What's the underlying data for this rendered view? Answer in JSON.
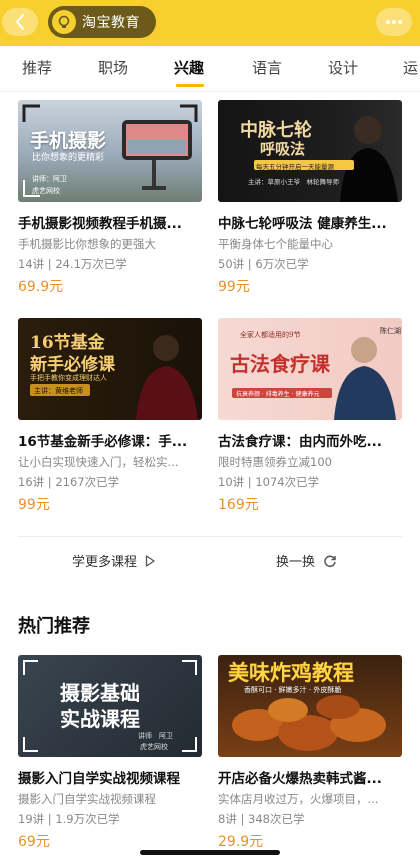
{
  "header": {
    "brand": "淘宝教育"
  },
  "tabs": [
    {
      "label": "推荐"
    },
    {
      "label": "职场"
    },
    {
      "label": "兴趣"
    },
    {
      "label": "语言"
    },
    {
      "label": "设计"
    },
    {
      "label": "运"
    }
  ],
  "courses": [
    {
      "title": "手机摄影视频教程手机摄...",
      "subtitle": "手机摄影比你想象的更强大",
      "lessons": "14讲",
      "learners": "24.1万次已学",
      "price": "69.9元",
      "thumb_text": [
        "手机摄影",
        "比你想象的更精彩",
        "讲师：阿卫",
        "虎艺网校"
      ]
    },
    {
      "title": "中脉七轮呼吸法 健康养生...",
      "subtitle": "平衡身体七个能量中心",
      "lessons": "50讲",
      "learners": "6万次已学",
      "price": "99元",
      "thumb_text": [
        "中脉七轮",
        "呼吸法",
        "每天五分钟开启一天能量源",
        "主讲：草原小王爷　林轮舞导师"
      ]
    },
    {
      "title": "16节基金新手必修课：手...",
      "subtitle": "让小白实现快速入门，轻松实...",
      "lessons": "16讲",
      "learners": "2167次已学",
      "price": "99元",
      "thumb_text": [
        "16节基金",
        "新手必修课",
        "手把手教你变成理财达人",
        "主讲：黄维老师"
      ]
    },
    {
      "title": "古法食疗课：由内而外吃...",
      "subtitle": "限时特惠领券立减100",
      "lessons": "10讲",
      "learners": "1074次已学",
      "price": "169元",
      "thumb_text": [
        "全家人都适用的9节",
        "古法食疗课",
        "抗衰养颜 · 排毒养生 · 健康养元",
        "陈仁湖"
      ]
    }
  ],
  "actions": {
    "more": "学更多课程",
    "refresh": "换一换"
  },
  "section": {
    "title": "热门推荐"
  },
  "hot": [
    {
      "title": "摄影入门自学实战视频课程",
      "subtitle": "摄影入门自学实战视频课程",
      "lessons": "19讲",
      "learners": "1.9万次已学",
      "price": "69元",
      "thumb_text": [
        "摄影基础",
        "实战课程",
        "讲师　阿卫",
        "虎艺网校"
      ]
    },
    {
      "title": "开店必备火爆热卖韩式酱...",
      "subtitle": "实体店月收过万，火爆项目，...",
      "lessons": "8讲",
      "learners": "348次已学",
      "price": "29.9元",
      "thumb_text": [
        "美味炸鸡教程",
        "香酥可口 · 鲜嫩多汁 · 外皮酥脆"
      ]
    }
  ],
  "colors": {
    "brand_yellow": "#f7cf2e",
    "price_orange": "#e8912c",
    "tab_underline": "#f7b500"
  }
}
